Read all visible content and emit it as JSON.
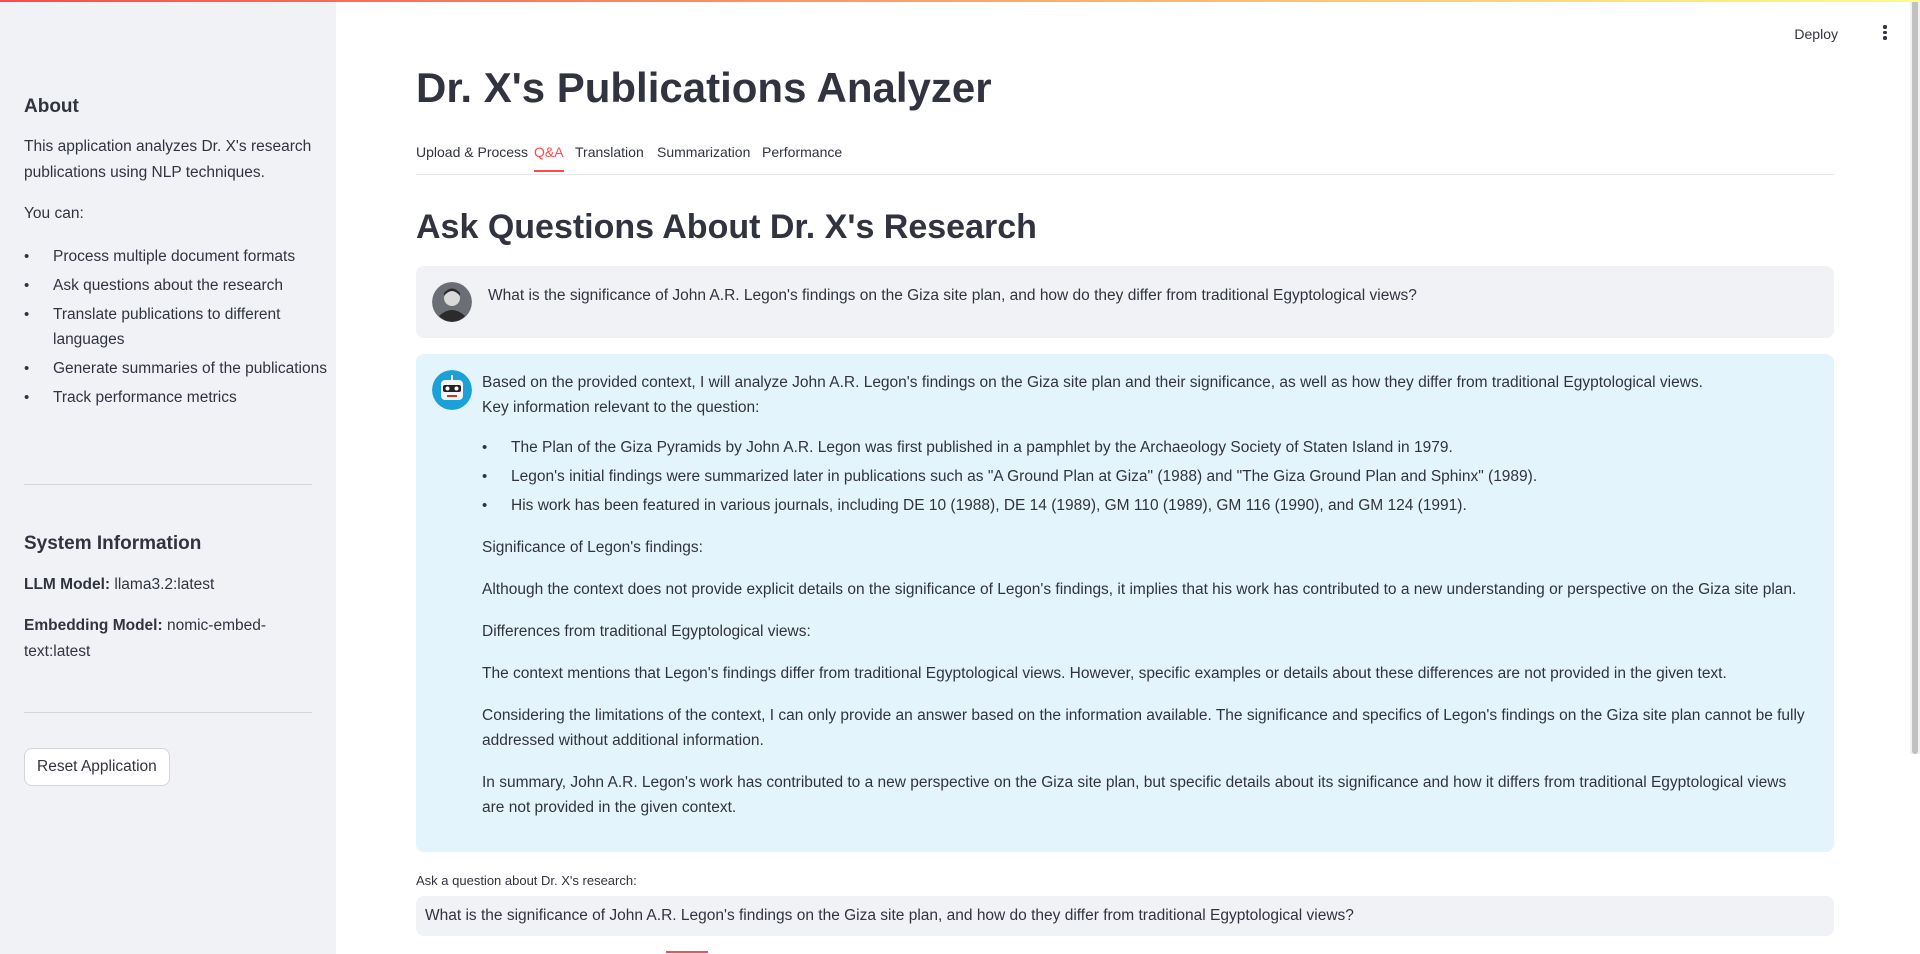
{
  "sidebar": {
    "about_heading": "About",
    "about_text": "This application analyzes Dr. X's research publications using NLP techniques.",
    "you_can": "You can:",
    "features": [
      "Process multiple document formats",
      "Ask questions about the research",
      "Translate publications to different languages",
      "Generate summaries of the publications",
      "Track performance metrics"
    ],
    "system_heading": "System Information",
    "llm_label": "LLM Model:",
    "llm_value": "llama3.2:latest",
    "embedding_label": "Embedding Model:",
    "embedding_value": "nomic-embed-text:latest",
    "reset_button": "Reset Application"
  },
  "header": {
    "deploy": "Deploy",
    "menu_icon": "kebab-menu-icon"
  },
  "main": {
    "title": "Dr. X's Publications Analyzer",
    "tabs": [
      {
        "label": "Upload & Process",
        "active": false
      },
      {
        "label": "Q&A",
        "active": true
      },
      {
        "label": "Translation",
        "active": false
      },
      {
        "label": "Summarization",
        "active": false
      },
      {
        "label": "Performance",
        "active": false
      }
    ],
    "section_title": "Ask Questions About Dr. X's Research",
    "user_message": "What is the significance of John A.R. Legon's findings on the Giza site plan, and how do they differ from traditional Egyptological views?",
    "assistant": {
      "intro_1": "Based on the provided context, I will analyze John A.R. Legon's findings on the Giza site plan and their significance, as well as how they differ from traditional Egyptological views.",
      "intro_2": "Key information relevant to the question:",
      "bullets": [
        "The Plan of the Giza Pyramids by John A.R. Legon was first published in a pamphlet by the Archaeology Society of Staten Island in 1979.",
        "Legon's initial findings were summarized later in publications such as \"A Ground Plan at Giza\" (1988) and \"The Giza Ground Plan and Sphinx\" (1989).",
        "His work has been featured in various journals, including DE 10 (1988), DE 14 (1989), GM 110 (1989), GM 116 (1990), and GM 124 (1991)."
      ],
      "sig_heading": "Significance of Legon's findings:",
      "sig_text": "Although the context does not provide explicit details on the significance of Legon's findings, it implies that his work has contributed to a new understanding or perspective on the Giza site plan.",
      "diff_heading": "Differences from traditional Egyptological views:",
      "diff_text": "The context mentions that Legon's findings differ from traditional Egyptological views. However, specific examples or details about these differences are not provided in the given text.",
      "limits_text": "Considering the limitations of the context, I can only provide an answer based on the information available. The significance and specifics of Legon's findings on the Giza site plan cannot be fully addressed without additional information.",
      "summary_text": "In summary, John A.R. Legon's work has contributed to a new perspective on the Giza site plan, but specific details about its significance and how it differs from traditional Egyptological views are not provided in the given context."
    },
    "input_label": "Ask a question about Dr. X's research:",
    "input_value": "What is the significance of John A.R. Legon's findings on the Giza site plan, and how do they differ from traditional Egyptological views?"
  },
  "colors": {
    "accent": "#ff4b4b",
    "sidebar_bg": "#f0f2f6",
    "assistant_bg": "#e4f4fc",
    "text": "#31333f"
  }
}
